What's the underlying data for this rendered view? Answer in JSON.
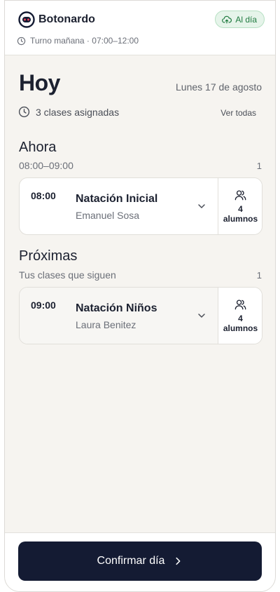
{
  "header": {
    "brand": "Botonardo",
    "status_label": "Al día",
    "shift": "Turno mañana · 07:00–12:00"
  },
  "main": {
    "title": "Hoy",
    "date": "Lunes 17 de agosto",
    "assigned": "3 clases asignadas",
    "see_all": "Ver todas"
  },
  "sections": [
    {
      "title": "Ahora",
      "subtitle": "08:00–09:00",
      "count": "1",
      "classes": [
        {
          "time": "08:00",
          "name": "Natación Inicial",
          "teacher": "Emanuel Sosa",
          "students_count": "4",
          "students_label": "alumnos"
        }
      ]
    },
    {
      "title": "Próximas",
      "subtitle": "Tus clases que siguen",
      "count": "1",
      "classes": [
        {
          "time": "09:00",
          "name": "Natación Niños",
          "teacher": "Laura Benitez",
          "students_count": "4",
          "students_label": "alumnos"
        }
      ]
    }
  ],
  "footer": {
    "confirm_label": "Confirmar día"
  },
  "icons": {
    "logo": "robot-logo-icon",
    "status": "cloud-upload-icon",
    "shift": "clock-icon",
    "assigned": "clock-icon",
    "expand": "chevron-down-icon",
    "students": "users-icon",
    "confirm": "chevron-right-icon"
  },
  "colors": {
    "primary": "#141b33",
    "status_bg": "#e6f4ea",
    "status_text": "#1f7a3f",
    "logo_accent": "#e0455a",
    "background": "#f6f4f0"
  }
}
